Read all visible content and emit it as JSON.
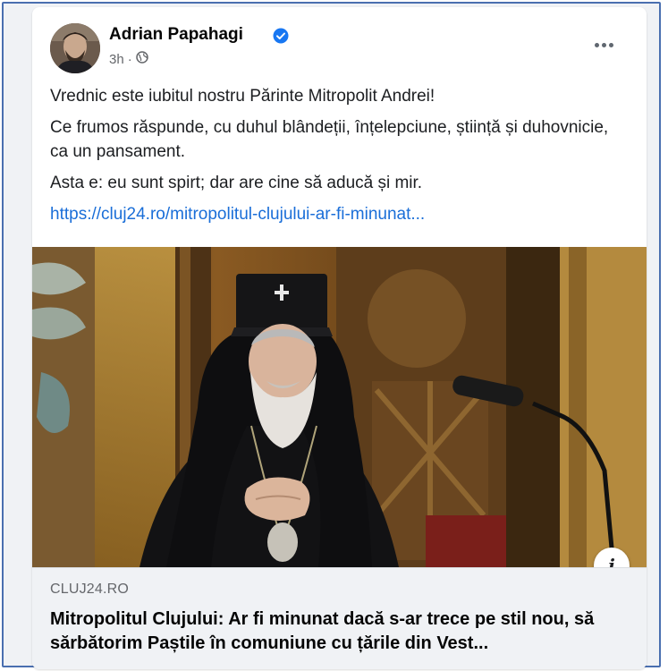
{
  "post": {
    "author": "Adrian Papahagi",
    "time": "3h",
    "time_separator": "·",
    "paragraphs": [
      "Vrednic este iubitul nostru Părinte Mitropolit Andrei!",
      "Ce frumos răspunde, cu duhul blândeții, înțelepciune, știință și duhovnicie, ca un pansament.",
      "Asta e: eu sunt spirt; dar are cine să aducă și mir."
    ],
    "link_text": "https://cluj24.ro/mitropolitul-clujului-ar-fi-minunat..."
  },
  "link_preview": {
    "domain": "CLUJ24.RO",
    "title": "Mitropolitul Clujului: Ar fi minunat dacă s-ar trece pe stil nou, să sărbătorim Paștile în comuniune cu țările din Vest...",
    "info_glyph": "i"
  },
  "icons": {
    "verified": "verified-badge-icon",
    "audience": "globe-icon",
    "more": "more-options-icon",
    "info": "info-icon"
  },
  "colors": {
    "link": "#1a6ed8",
    "verified": "#1877f2",
    "meta_text": "#65676b",
    "preview_bg": "#f0f2f5"
  }
}
